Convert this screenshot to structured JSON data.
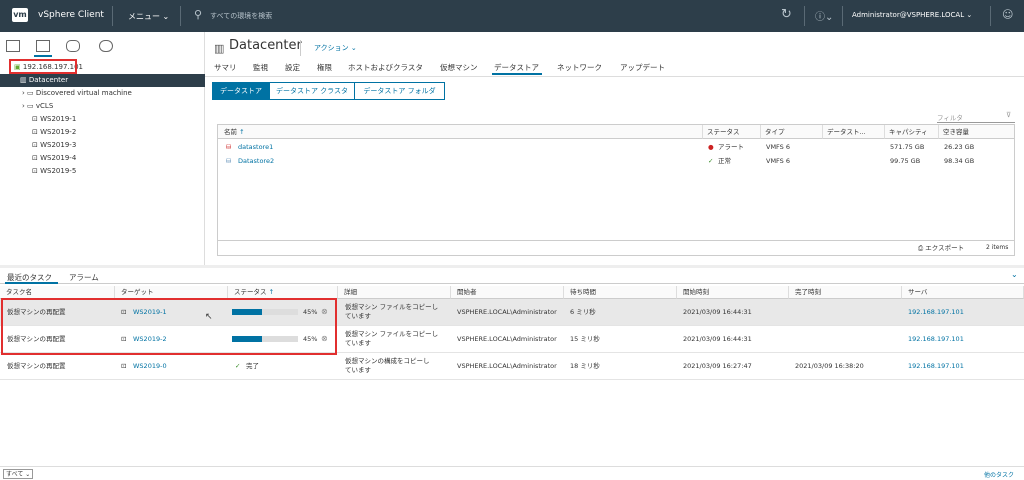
{
  "header": {
    "logo": "vm",
    "app": "vSphere Client",
    "menu": "メニュー",
    "search": "すべての環境を検索",
    "user": "Administrator@VSPHERE.LOCAL"
  },
  "tree": {
    "host": "192.168.197.101",
    "dc": "Datacenter",
    "items": [
      "Discovered virtual machine",
      "vCLS",
      "WS2019-1",
      "WS2019-2",
      "WS2019-3",
      "WS2019-4",
      "WS2019-5"
    ]
  },
  "main": {
    "title": "Datacenter",
    "actions": "アクション",
    "tabs": [
      "サマリ",
      "監視",
      "設定",
      "権限",
      "ホストおよびクラスタ",
      "仮想マシン",
      "データストア",
      "ネットワーク",
      "アップデート"
    ],
    "subtabs": [
      "データストア",
      "データストア クラスタ",
      "データストア フォルダ"
    ],
    "filter": "フィルタ",
    "cols": [
      "名前",
      "ステータス",
      "タイプ",
      "データスト...",
      "キャパシティ",
      "空き容量"
    ],
    "rows": [
      {
        "name": "datastore1",
        "status": "アラート",
        "type": "VMFS 6",
        "cap": "571.75 GB",
        "free": "26.23 GB"
      },
      {
        "name": "Datastore2",
        "status": "正常",
        "type": "VMFS 6",
        "cap": "99.75 GB",
        "free": "98.34 GB"
      }
    ],
    "export": "エクスポート",
    "count": "2 items"
  },
  "tasks": {
    "tab1": "最近のタスク",
    "tab2": "アラーム",
    "cols": [
      "タスク名",
      "ターゲット",
      "ステータス",
      "詳細",
      "開始者",
      "待ち時間",
      "開始時刻",
      "完了時刻",
      "サーバ"
    ],
    "rows": [
      {
        "task": "仮想マシンの再配置",
        "target": "WS2019-1",
        "pct": "45%",
        "progress": 0.45,
        "detail1": "仮想マシン ファイルをコピーし",
        "detail2": "ています",
        "by": "VSPHERE.LOCAL\\Administrator",
        "wait": "6 ミリ秒",
        "start": "2021/03/09 16:44:31",
        "end": "",
        "server": "192.168.197.101"
      },
      {
        "task": "仮想マシンの再配置",
        "target": "WS2019-2",
        "pct": "45%",
        "progress": 0.45,
        "detail1": "仮想マシン ファイルをコピーし",
        "detail2": "ています",
        "by": "VSPHERE.LOCAL\\Administrator",
        "wait": "15 ミリ秒",
        "start": "2021/03/09 16:44:31",
        "end": "",
        "server": "192.168.197.101"
      },
      {
        "task": "仮想マシンの再配置",
        "target": "WS2019-0",
        "status": "完了",
        "detail1": "仮想マシンの構成をコピーし",
        "detail2": "ています",
        "by": "VSPHERE.LOCAL\\Administrator",
        "wait": "18 ミリ秒",
        "start": "2021/03/09 16:27:47",
        "end": "2021/03/09 16:38:20",
        "server": "192.168.197.101"
      }
    ],
    "footer_left": "すべて",
    "footer_right": "他のタスク"
  }
}
